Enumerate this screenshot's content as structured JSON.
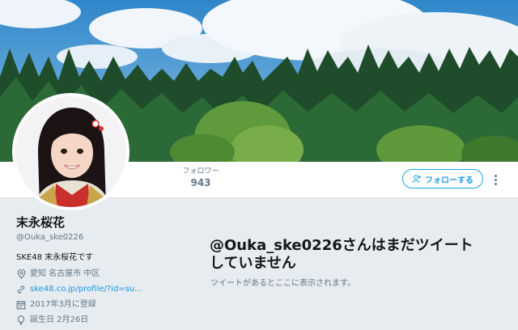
{
  "banner": {
    "alt": "forest and sky header"
  },
  "stats": {
    "followers_label": "フォロワー",
    "followers_value": "943"
  },
  "actions": {
    "follow_label": "フォローする"
  },
  "profile": {
    "name": "末永桜花",
    "handle": "@Ouka_ske0226",
    "bio": "SKE48 末永桜花です",
    "location": "愛知 名古屋市 中区",
    "url": "ske48.co.jp/profile/?id=su...",
    "joined": "2017年3月に登録",
    "birthday": "誕生日 2月26日"
  },
  "timeline": {
    "empty_title": "@Ouka_ske0226さんはまだツイートしていません",
    "empty_subtitle": "ツイートがあるとここに表示されます。"
  },
  "colors": {
    "accent": "#1da1f2",
    "link": "#1b95e0",
    "muted": "#657786",
    "background": "#e6ecf0"
  }
}
